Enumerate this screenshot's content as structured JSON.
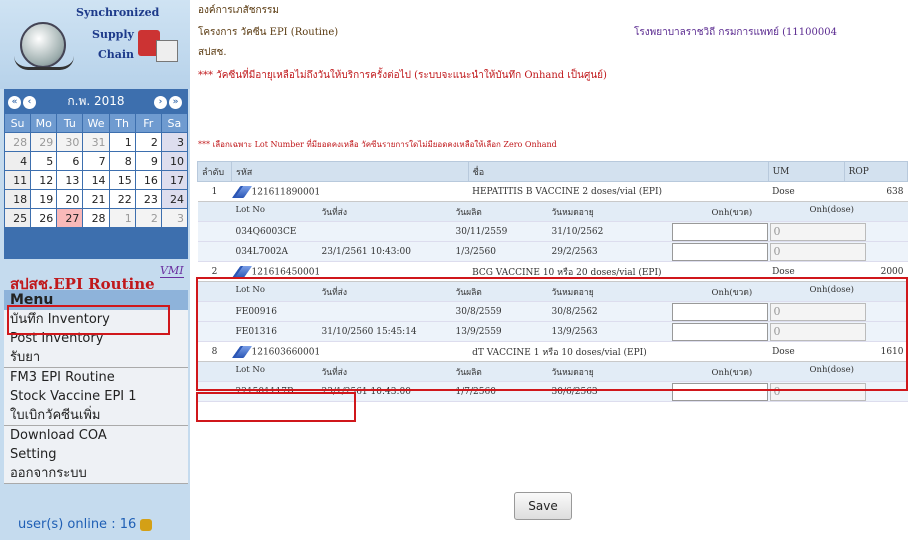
{
  "logo": {
    "line1": "Synchronized",
    "line2": "Supply",
    "line3": "Chain"
  },
  "calendar": {
    "month": "ก.พ. 2018",
    "dow": [
      "Su",
      "Mo",
      "Tu",
      "We",
      "Th",
      "Fr",
      "Sa"
    ],
    "weeks": [
      [
        "28",
        "29",
        "30",
        "31",
        "1",
        "2",
        "3"
      ],
      [
        "4",
        "5",
        "6",
        "7",
        "8",
        "9",
        "10"
      ],
      [
        "11",
        "12",
        "13",
        "14",
        "15",
        "16",
        "17"
      ],
      [
        "18",
        "19",
        "20",
        "21",
        "22",
        "23",
        "24"
      ],
      [
        "25",
        "26",
        "27",
        "28",
        "1",
        "2",
        "3"
      ]
    ]
  },
  "brand": "สปสช.EPI Routine",
  "vmi": "VMI",
  "menu": {
    "title": "Menu",
    "items": [
      "บันทึก Inventory",
      "Post Inventory",
      "รับยา",
      "FM3 EPI Routine",
      "Stock Vaccine EPI 1",
      "ใบเบิกวัคซีนเพิ่ม",
      "Download COA",
      "Setting",
      "ออกจากระบบ"
    ]
  },
  "online": "user(s) online : 16",
  "header": {
    "l1": "องค์การเภสัชกรรม",
    "l2": "โครงการ วัคซีน EPI (Routine)",
    "l3": "สปสช.",
    "hospital": "โรงพยาบาลราชวิถี กรมการแพทย์ (11100004",
    "note1": "*** วัคซีนที่มีอายุเหลือไม่ถึงวันให้บริการครั้งต่อไป (ระบบจะแนะนำให้บันทึก Onhand เป็นศูนย์)",
    "note2": "*** เลือกเฉพาะ Lot Number ที่มียอดคงเหลือ วัคซีนรายการใดไม่มียอดคงเหลือให้เลือก Zero Onhand"
  },
  "grid": {
    "cols": [
      "ลำดับ",
      "รหัส",
      "ชื่อ",
      "UM",
      "ROP"
    ],
    "lotcols": [
      "Lot No",
      "วันที่ส่ง",
      "วันผลิต",
      "วันหมดอายุ",
      "Onh(ขวด)",
      "Onh(dose)"
    ],
    "items": [
      {
        "no": "1",
        "code": "121611890001",
        "name": "HEPATITIS B VACCINE 2 doses/vial (EPI)",
        "um": "Dose",
        "rop": "638",
        "lots": [
          [
            "034Q6003CE",
            "",
            "30/11/2559",
            "31/10/2562",
            "0"
          ],
          [
            "034L7002A",
            "23/1/2561 10:43:00",
            "1/3/2560",
            "29/2/2563",
            "0"
          ]
        ]
      },
      {
        "no": "2",
        "code": "121616450001",
        "name": "BCG VACCINE 10 หรือ 20 doses/vial (EPI)",
        "um": "Dose",
        "rop": "2000",
        "lots": [
          [
            "FE00916",
            "",
            "30/8/2559",
            "30/8/2562",
            "0"
          ],
          [
            "FE01316",
            "31/10/2560 15:45:14",
            "13/9/2559",
            "13/9/2563",
            "0"
          ]
        ]
      },
      {
        "no": "8",
        "code": "121603660001",
        "name": "dT VACCINE 1 หรือ 10 doses/vial (EPI)",
        "um": "Dose",
        "rop": "1610",
        "lots": [
          [
            "221501117B",
            "23/1/2561 10:43:00",
            "1/7/2560",
            "30/6/2563",
            "0"
          ]
        ]
      }
    ]
  },
  "save": "Save"
}
